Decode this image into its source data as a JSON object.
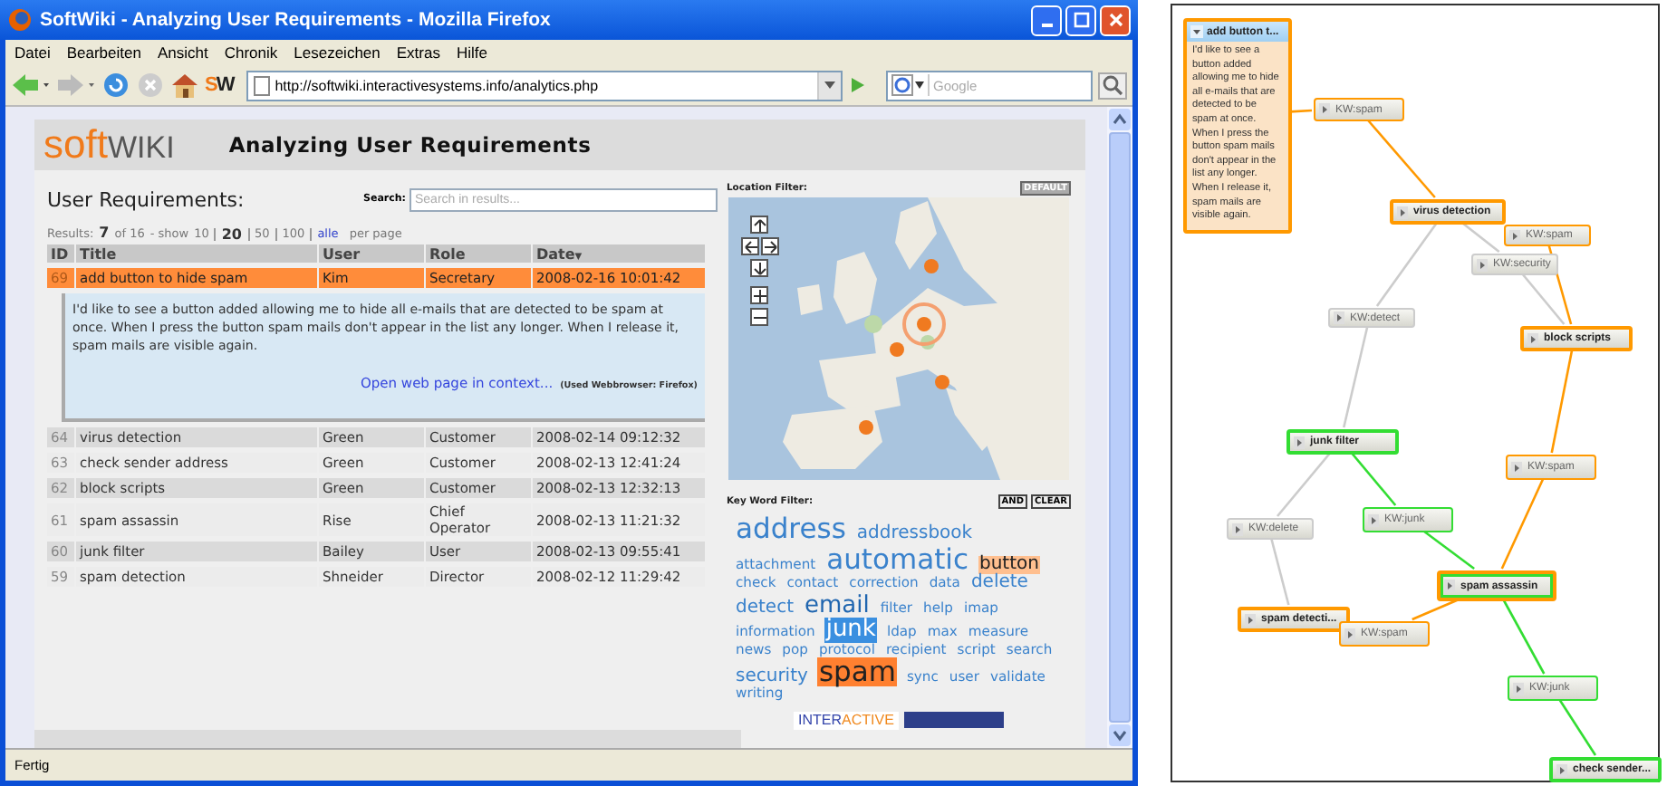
{
  "window": {
    "title": "SoftWiki - Analyzing User Requirements - Mozilla Firefox"
  },
  "menu": [
    "Datei",
    "Bearbeiten",
    "Ansicht",
    "Chronik",
    "Lesezeichen",
    "Extras",
    "Hilfe"
  ],
  "toolbar": {
    "logo": [
      "S",
      "W"
    ],
    "url": "http://softwiki.interactivesystems.info/analytics.php",
    "search_placeholder": "Google"
  },
  "page": {
    "logo": [
      "soft",
      "WIKI"
    ],
    "heading": "Analyzing User Requirements"
  },
  "requirements": {
    "title": "User Requirements:",
    "search_label": "Search:",
    "search_placeholder": "Search in results...",
    "results_label": "Results:",
    "count": "7",
    "total": "of 16",
    "show_label": "- show",
    "per_page": "per page",
    "page_sizes": [
      {
        "label": "10",
        "selected": false,
        "kind": "plain"
      },
      {
        "label": "20",
        "selected": true,
        "kind": "plain"
      },
      {
        "label": "50",
        "selected": false,
        "kind": "plain"
      },
      {
        "label": "100",
        "selected": false,
        "kind": "plain"
      },
      {
        "label": "alle",
        "selected": false,
        "kind": "link"
      }
    ]
  },
  "table": {
    "columns": [
      {
        "label": "ID"
      },
      {
        "label": "Title"
      },
      {
        "label": "User"
      },
      {
        "label": "Role"
      },
      {
        "label": "Date",
        "sort_mark": "▼"
      }
    ],
    "rows": [
      {
        "id": "69",
        "title": "add button to hide spam",
        "user": "Kim",
        "role": "Secretary",
        "date": "2008-02-16 10:01:42",
        "selected": true,
        "detail": {
          "text": "I'd like to see a button added allowing me to hide all e-mails that are detected to be spam at once. When I press the button spam mails don't appear in the list any longer. When I release it, spam mails are visible again.",
          "link": "Open web page in context...",
          "note": "(Used Webbrowser: Firefox)"
        }
      },
      {
        "id": "64",
        "title": "virus detection",
        "user": "Green",
        "role": "Customer",
        "date": "2008-02-14 09:12:32",
        "selected": false
      },
      {
        "id": "63",
        "title": "check sender address",
        "user": "Green",
        "role": "Customer",
        "date": "2008-02-13 12:41:24",
        "selected": false
      },
      {
        "id": "62",
        "title": "block scripts",
        "user": "Green",
        "role": "Customer",
        "date": "2008-02-13 12:32:13",
        "selected": false
      },
      {
        "id": "61",
        "title": "spam assassin",
        "user": "Rise",
        "role": "Chief Operator",
        "date": "2008-02-13 11:21:32",
        "selected": false
      },
      {
        "id": "60",
        "title": "junk filter",
        "user": "Bailey",
        "role": "User",
        "date": "2008-02-13 09:55:41",
        "selected": false
      },
      {
        "id": "59",
        "title": "spam detection",
        "user": "Shneider",
        "role": "Director",
        "date": "2008-02-12 11:29:42",
        "selected": false
      }
    ]
  },
  "location_filter": {
    "label": "Location Filter:",
    "button": "DEFAULT"
  },
  "keyword_filter": {
    "label": "Key Word Filter:",
    "buttons": [
      "AND",
      "CLEAR"
    ],
    "tags": [
      {
        "label": "address",
        "kind": "huge"
      },
      {
        "label": "addressbook",
        "kind": "medium"
      },
      {
        "label": "attachment",
        "kind": "small"
      },
      {
        "label": "automatic",
        "kind": "huge"
      },
      {
        "label": "button",
        "kind": "medium",
        "color": "#ffbf8f"
      },
      {
        "label": "check",
        "kind": "small"
      },
      {
        "label": "contact",
        "kind": "small"
      },
      {
        "label": "correction",
        "kind": "small"
      },
      {
        "label": "data",
        "kind": "small"
      },
      {
        "label": "delete",
        "kind": "medium"
      },
      {
        "label": "detect",
        "kind": "medium"
      },
      {
        "label": "email",
        "kind": "large"
      },
      {
        "label": "filter",
        "kind": "small"
      },
      {
        "label": "help",
        "kind": "small"
      },
      {
        "label": "imap",
        "kind": "small"
      },
      {
        "label": "information",
        "kind": "small"
      },
      {
        "label": "junk",
        "kind": "large",
        "color": "#3a8fe0"
      },
      {
        "label": "ldap",
        "kind": "small"
      },
      {
        "label": "max",
        "kind": "small"
      },
      {
        "label": "measure",
        "kind": "small"
      },
      {
        "label": "news",
        "kind": "small"
      },
      {
        "label": "pop",
        "kind": "small"
      },
      {
        "label": "protocol",
        "kind": "small"
      },
      {
        "label": "recipient",
        "kind": "small"
      },
      {
        "label": "script",
        "kind": "small"
      },
      {
        "label": "search",
        "kind": "small"
      },
      {
        "label": "security",
        "kind": "medium"
      },
      {
        "label": "spam",
        "kind": "huge",
        "color": "#ff8030"
      },
      {
        "label": "sync",
        "kind": "small"
      },
      {
        "label": "user",
        "kind": "small"
      },
      {
        "label": "validate",
        "kind": "small"
      },
      {
        "label": "writing",
        "kind": "small"
      }
    ]
  },
  "footer_logo": [
    "INTER",
    "ACTIVE"
  ],
  "status_bar": "Fertig",
  "graph": {
    "nodes": [
      {
        "label": "add button t...",
        "kind": "note",
        "color": "#ff9900",
        "highlighted": false,
        "text": "I'd like to see a button added allowing me to hide all e-mails that are detected to be spam at once. When I press the button spam mails don't appear in the list any longer. When I release it, spam mails are visible again."
      },
      {
        "label": "KW:spam",
        "kind": "keyword",
        "color": "#ff9900",
        "highlighted": false
      },
      {
        "label": "virus detection",
        "kind": "requirement",
        "color": "#ff9900",
        "highlighted": false
      },
      {
        "label": "KW:spam",
        "kind": "keyword",
        "color": "#ff9900",
        "highlighted": false
      },
      {
        "label": "KW:security",
        "kind": "keyword",
        "color": "#cccccc",
        "highlighted": false
      },
      {
        "label": "KW:detect",
        "kind": "keyword",
        "color": "#cccccc",
        "highlighted": false
      },
      {
        "label": "block scripts",
        "kind": "requirement",
        "color": "#ff9900",
        "highlighted": false
      },
      {
        "label": "junk filter",
        "kind": "requirement",
        "color": "#33dd33",
        "highlighted": false
      },
      {
        "label": "KW:spam",
        "kind": "keyword",
        "color": "#ff9900",
        "highlighted": false
      },
      {
        "label": "KW:junk",
        "kind": "keyword",
        "color": "#33dd33",
        "highlighted": false
      },
      {
        "label": "KW:delete",
        "kind": "keyword",
        "color": "#cccccc",
        "highlighted": false
      },
      {
        "label": "spam assassin",
        "kind": "requirement",
        "color": "#ff9900",
        "highlighted": true
      },
      {
        "label": "spam detecti...",
        "kind": "requirement",
        "color": "#ff9900",
        "highlighted": false
      },
      {
        "label": "KW:spam",
        "kind": "keyword",
        "color": "#ff9900",
        "highlighted": false
      },
      {
        "label": "KW:junk",
        "kind": "keyword",
        "color": "#33dd33",
        "highlighted": false
      },
      {
        "label": "check sender...",
        "kind": "requirement",
        "color": "#33dd33",
        "highlighted": false
      }
    ]
  }
}
